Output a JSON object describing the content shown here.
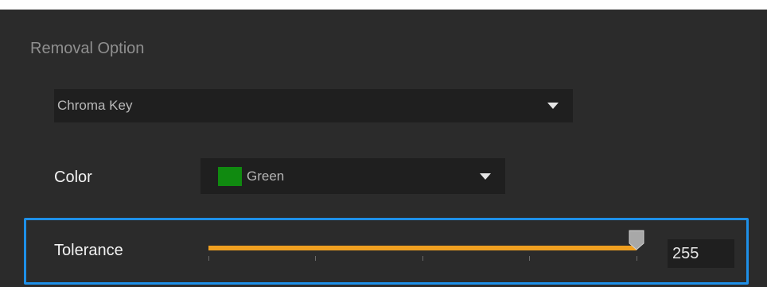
{
  "section": {
    "title": "Removal Option"
  },
  "removal_dropdown": {
    "selected": "Chroma Key"
  },
  "color": {
    "label": "Color",
    "selected": "Green",
    "swatch_color": "#108a10"
  },
  "tolerance": {
    "label": "Tolerance",
    "value": "255",
    "slider_fraction": 1.0,
    "track_color": "#f0a020"
  },
  "colors": {
    "panel_bg": "#2b2b2b",
    "field_bg": "#1f1f1f",
    "highlight_border": "#1e90e8"
  }
}
